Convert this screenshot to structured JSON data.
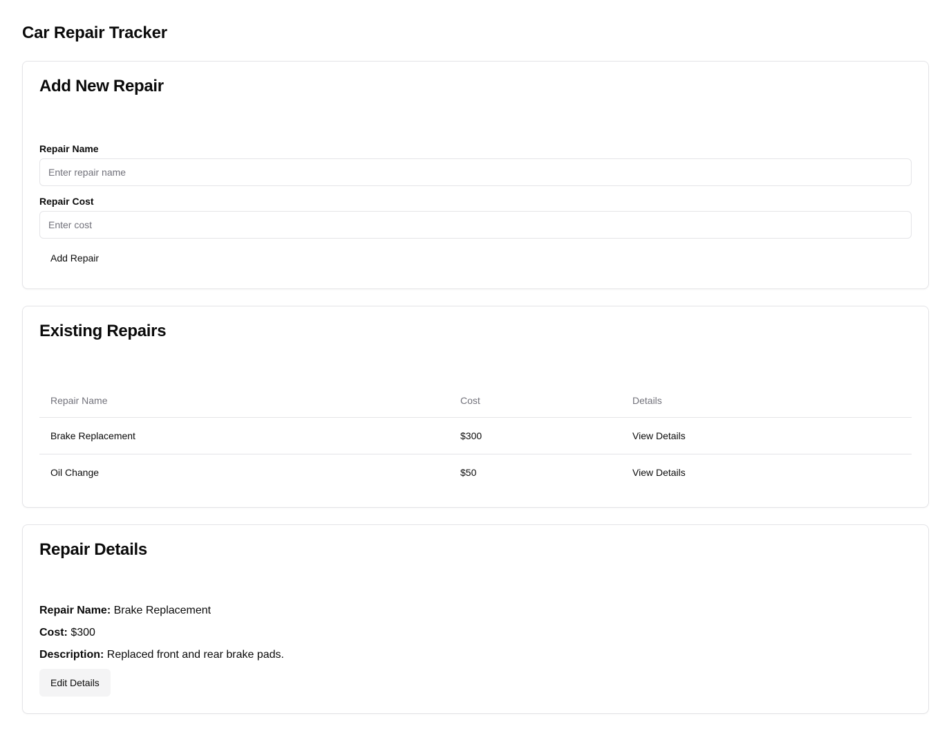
{
  "app": {
    "title": "Car Repair Tracker"
  },
  "add_repair": {
    "title": "Add New Repair",
    "name_label": "Repair Name",
    "name_placeholder": "Enter repair name",
    "name_value": "",
    "cost_label": "Repair Cost",
    "cost_placeholder": "Enter cost",
    "cost_value": "",
    "submit_label": "Add Repair"
  },
  "existing_repairs": {
    "title": "Existing Repairs",
    "columns": [
      "Repair Name",
      "Cost",
      "Details"
    ],
    "rows": [
      {
        "name": "Brake Replacement",
        "cost": "$300",
        "action": "View Details"
      },
      {
        "name": "Oil Change",
        "cost": "$50",
        "action": "View Details"
      }
    ]
  },
  "repair_details": {
    "title": "Repair Details",
    "name_label": "Repair Name:",
    "name_value": "Brake Replacement",
    "cost_label": "Cost:",
    "cost_value": "$300",
    "description_label": "Description:",
    "description_value": "Replaced front and rear brake pads.",
    "edit_label": "Edit Details"
  },
  "colors": {
    "text": "#0a0a0a",
    "muted": "#71717a",
    "border": "#e4e4e7",
    "secondary_bg": "#f4f4f5"
  }
}
